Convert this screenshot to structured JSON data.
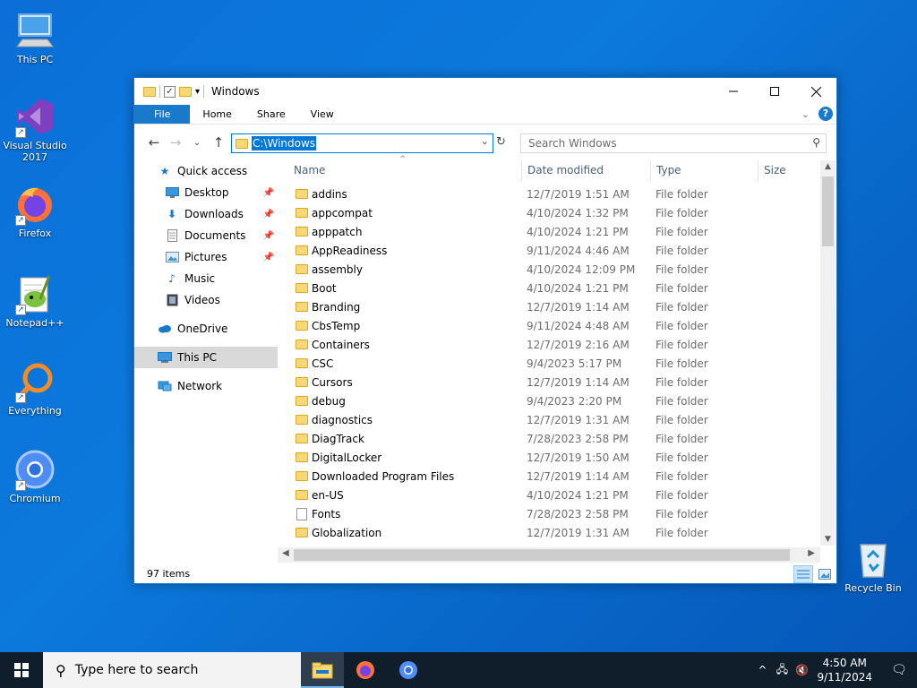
{
  "desktop": {
    "icons": [
      {
        "label": "This PC"
      },
      {
        "label": "Visual Studio 2017"
      },
      {
        "label": "Firefox"
      },
      {
        "label": "Notepad++"
      },
      {
        "label": "Everything"
      },
      {
        "label": "Chromium"
      },
      {
        "label": "Recycle Bin"
      }
    ]
  },
  "window": {
    "title": "Windows",
    "ribbon_tabs": [
      "File",
      "Home",
      "Share",
      "View"
    ],
    "address": "C:\\Windows",
    "search_placeholder": "Search Windows",
    "nav": {
      "quick_access": "Quick access",
      "quick_items": [
        "Desktop",
        "Downloads",
        "Documents",
        "Pictures",
        "Music",
        "Videos"
      ],
      "onedrive": "OneDrive",
      "this_pc": "This PC",
      "network": "Network"
    },
    "columns": {
      "name": "Name",
      "date": "Date modified",
      "type": "Type",
      "size": "Size"
    },
    "rows": [
      {
        "name": "addins",
        "date": "12/7/2019 1:51 AM",
        "type": "File folder",
        "icon": "folder"
      },
      {
        "name": "appcompat",
        "date": "4/10/2024 1:32 PM",
        "type": "File folder",
        "icon": "folder"
      },
      {
        "name": "apppatch",
        "date": "4/10/2024 1:21 PM",
        "type": "File folder",
        "icon": "folder"
      },
      {
        "name": "AppReadiness",
        "date": "9/11/2024 4:46 AM",
        "type": "File folder",
        "icon": "folder"
      },
      {
        "name": "assembly",
        "date": "4/10/2024 12:09 PM",
        "type": "File folder",
        "icon": "folder"
      },
      {
        "name": "Boot",
        "date": "4/10/2024 1:21 PM",
        "type": "File folder",
        "icon": "folder"
      },
      {
        "name": "Branding",
        "date": "12/7/2019 1:14 AM",
        "type": "File folder",
        "icon": "folder"
      },
      {
        "name": "CbsTemp",
        "date": "9/11/2024 4:48 AM",
        "type": "File folder",
        "icon": "folder"
      },
      {
        "name": "Containers",
        "date": "12/7/2019 2:16 AM",
        "type": "File folder",
        "icon": "folder"
      },
      {
        "name": "CSC",
        "date": "9/4/2023 5:17 PM",
        "type": "File folder",
        "icon": "folder"
      },
      {
        "name": "Cursors",
        "date": "12/7/2019 1:14 AM",
        "type": "File folder",
        "icon": "folder"
      },
      {
        "name": "debug",
        "date": "9/4/2023 2:20 PM",
        "type": "File folder",
        "icon": "folder"
      },
      {
        "name": "diagnostics",
        "date": "12/7/2019 1:31 AM",
        "type": "File folder",
        "icon": "folder"
      },
      {
        "name": "DiagTrack",
        "date": "7/28/2023 2:58 PM",
        "type": "File folder",
        "icon": "folder"
      },
      {
        "name": "DigitalLocker",
        "date": "12/7/2019 1:50 AM",
        "type": "File folder",
        "icon": "folder"
      },
      {
        "name": "Downloaded Program Files",
        "date": "12/7/2019 1:14 AM",
        "type": "File folder",
        "icon": "folder"
      },
      {
        "name": "en-US",
        "date": "4/10/2024 1:21 PM",
        "type": "File folder",
        "icon": "folder"
      },
      {
        "name": "Fonts",
        "date": "7/28/2023 2:58 PM",
        "type": "File folder",
        "icon": "document"
      },
      {
        "name": "Globalization",
        "date": "12/7/2019 1:31 AM",
        "type": "File folder",
        "icon": "folder"
      }
    ],
    "status": "97 items"
  },
  "taskbar": {
    "search_placeholder": "Type here to search",
    "time": "4:50 AM",
    "date": "9/11/2024"
  },
  "colors": {
    "accent": "#1979ca",
    "desktop": "#0a6fd8",
    "taskbar": "#101d2b"
  }
}
